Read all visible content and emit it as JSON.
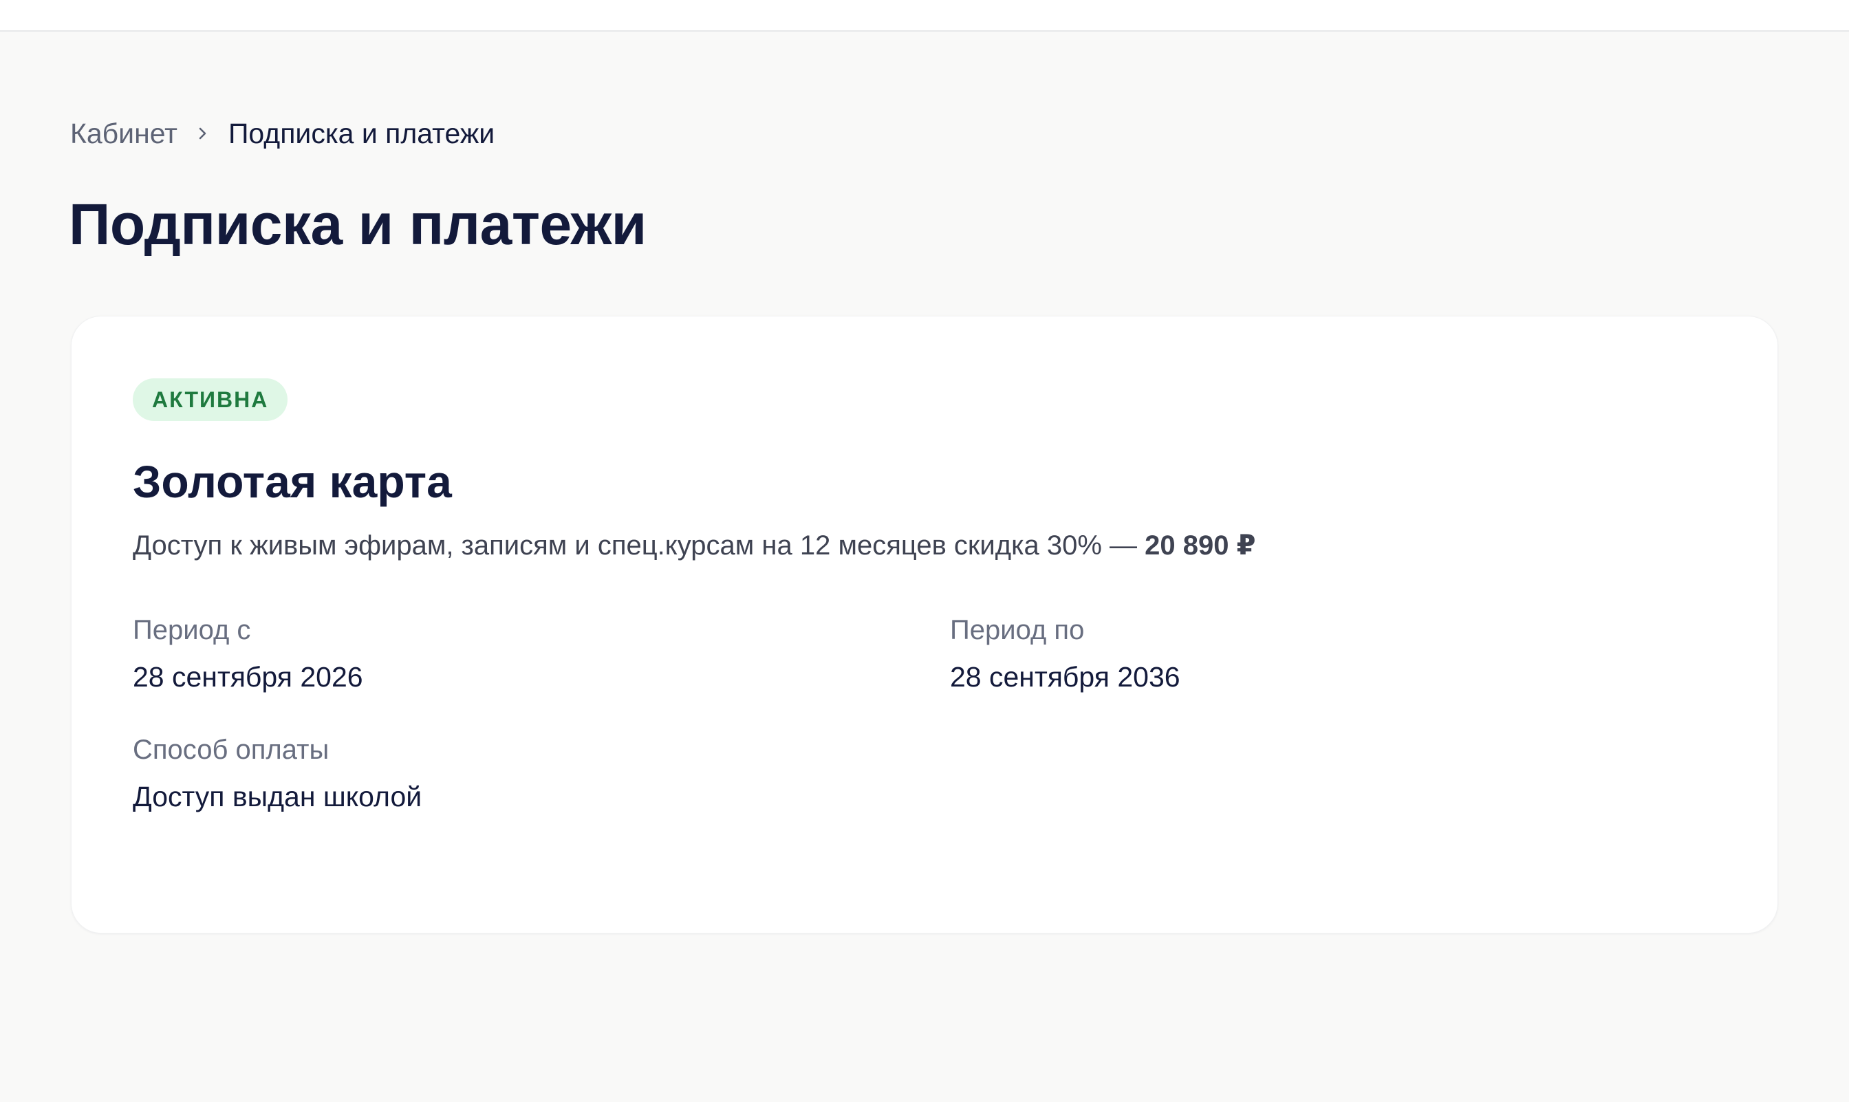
{
  "breadcrumb": {
    "root": "Кабинет",
    "current": "Подписка и платежи"
  },
  "page": {
    "title": "Подписка и платежи"
  },
  "subscription": {
    "status": "АКТИВНА",
    "name": "Золотая карта",
    "description": "Доступ к живым эфирам, записям и спец.курсам на 12 месяцев скидка 30% — ",
    "price": "20 890 ₽",
    "period_from_label": "Период с",
    "period_from": "28 сентября 2026",
    "period_to_label": "Период по",
    "period_to": "28 сентября 2036",
    "payment_method_label": "Способ оплаты",
    "payment_method": "Доступ выдан школой"
  },
  "colors": {
    "background": "#f9f9f8",
    "text_primary": "#131a3b",
    "badge_bg": "#dff7e6",
    "badge_text": "#1f7a3f"
  },
  "icons": {
    "breadcrumb_separator": "chevron-right-icon"
  }
}
